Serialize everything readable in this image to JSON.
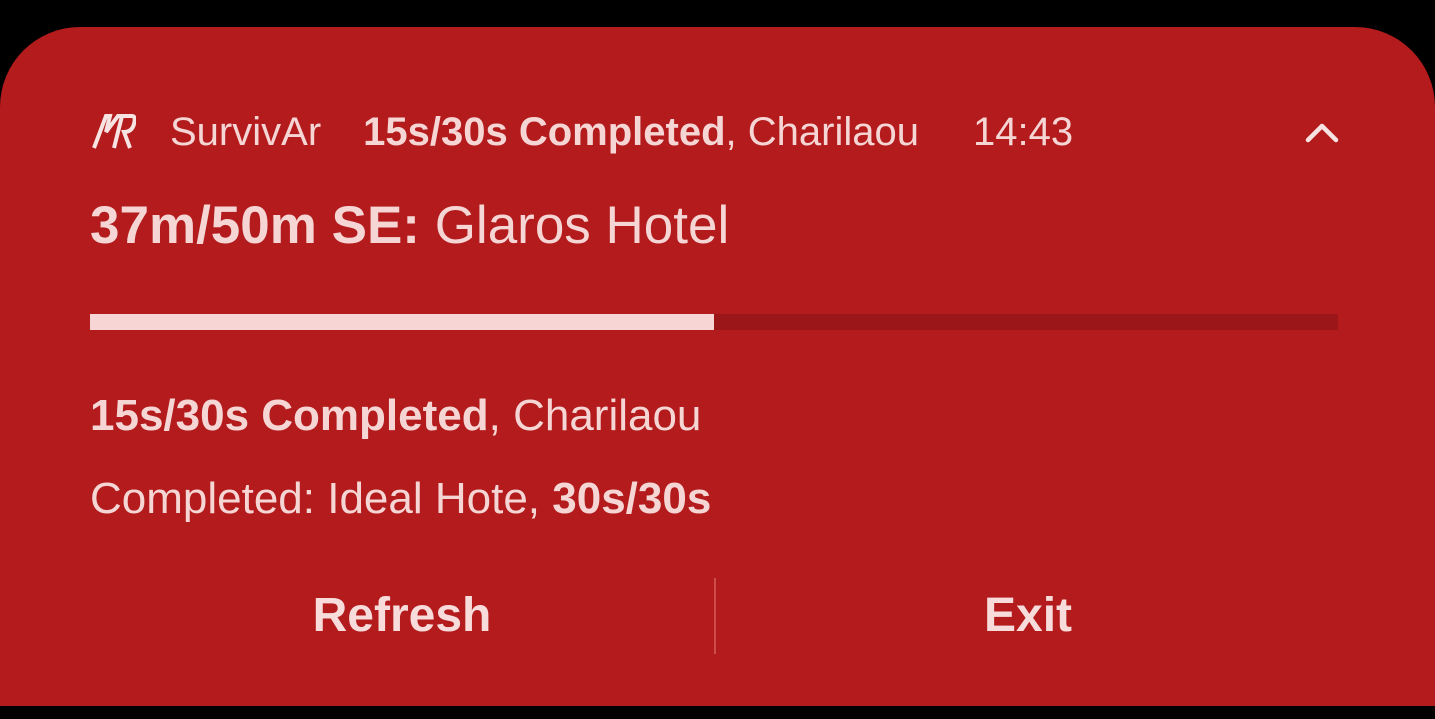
{
  "notification": {
    "app_icon": "survivar-logo-icon",
    "app_name": "SurvivAr",
    "header_status_bold": "15s/30s Completed",
    "header_status_rest": ", Charilaou",
    "time": "14:43",
    "collapse_icon": "chevron-up-icon",
    "title_bold": "37m/50m SE:",
    "title_rest": " Glaros Hotel",
    "progress_fraction": 0.5,
    "line1_bold": "15s/30s Completed",
    "line1_rest": ", Charilaou",
    "line2_text": "Completed: Ideal Hote, ",
    "line2_bold": "30s/30s",
    "actions": {
      "refresh": "Refresh",
      "exit": "Exit"
    }
  },
  "colors": {
    "background": "#b31b1d",
    "text": "#f5d6d4",
    "progress_track": "#9a1618",
    "progress_fill": "#f6d5d4"
  }
}
